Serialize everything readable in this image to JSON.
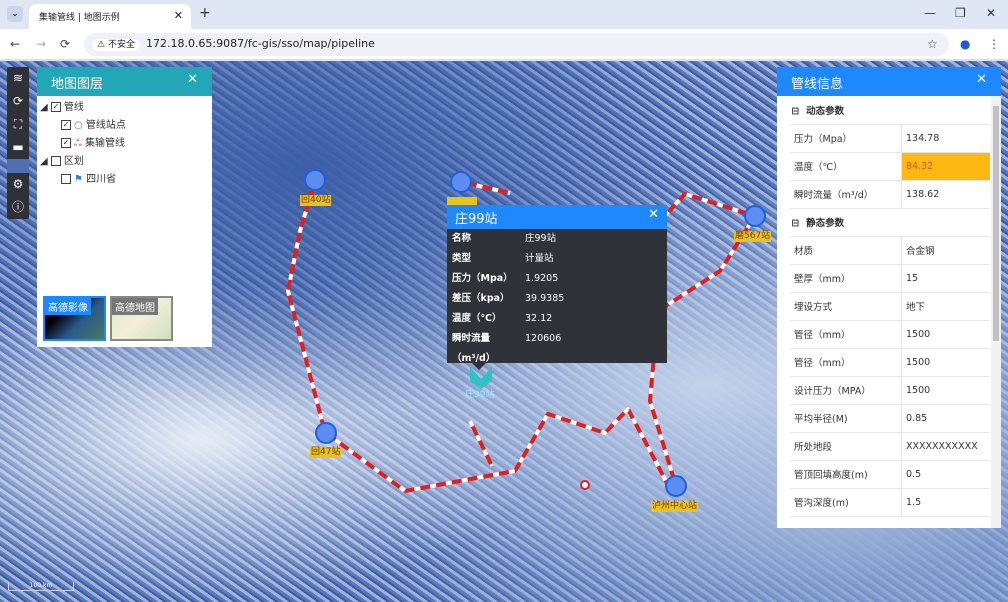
{
  "browser": {
    "tab_title": "集输管线 | 地图示例",
    "url": "172.18.0.65:9087/fc-gis/sso/map/pipeline",
    "security_label": "不安全"
  },
  "layers_panel": {
    "title": "地图图层",
    "tree": [
      {
        "label": "管线",
        "checked": true,
        "children": [
          {
            "label": "管线站点",
            "checked": true,
            "icon": "circle-icon"
          },
          {
            "label": "集输管线",
            "checked": true,
            "icon": "pipeline-icon"
          }
        ]
      },
      {
        "label": "区划",
        "checked": false,
        "children": [
          {
            "label": "四川省",
            "checked": false,
            "icon": "region-flag-icon"
          }
        ]
      }
    ],
    "basemaps": [
      {
        "label": "高德影像",
        "active": true
      },
      {
        "label": "高德地图",
        "active": false
      }
    ]
  },
  "info_panel": {
    "title": "管线信息",
    "groups": [
      {
        "title": "动态参数",
        "rows": [
          {
            "k": "压力（Mpa）",
            "v": "134.78"
          },
          {
            "k": "温度（℃）",
            "v": "84.32",
            "highlight": true
          },
          {
            "k": "瞬时流量（m³/d）",
            "v": "138.62"
          }
        ]
      },
      {
        "title": "静态参数",
        "rows": [
          {
            "k": "材质",
            "v": "合金钢"
          },
          {
            "k": "壁厚（mm）",
            "v": "15"
          },
          {
            "k": "埋设方式",
            "v": "地下"
          },
          {
            "k": "管径（mm）",
            "v": "1500"
          },
          {
            "k": "管径（mm）",
            "v": "1500"
          },
          {
            "k": "设计压力（MPA）",
            "v": "1500"
          },
          {
            "k": "平均半径(M)",
            "v": "0.85"
          },
          {
            "k": "所处地段",
            "v": "XXXXXXXXXXX"
          },
          {
            "k": "管顶回填高度(m)",
            "v": "0.5"
          },
          {
            "k": "管沟深度(m)",
            "v": "1.5"
          }
        ]
      }
    ],
    "highlight_color": "#fdb913"
  },
  "popup": {
    "title": "庄99站",
    "rows": [
      {
        "k": "名称",
        "v": "庄99站"
      },
      {
        "k": "类型",
        "v": "计量站"
      },
      {
        "k": "压力（Mpa）",
        "v": "1.9205"
      },
      {
        "k": "差压（kpa）",
        "v": "39.9385"
      },
      {
        "k": "温度（℃）",
        "v": "32.12"
      },
      {
        "k": "瞬时流量（m³/d）",
        "v": "120606"
      }
    ]
  },
  "stations": {
    "s40": "回40站",
    "s47": "回47站",
    "luzhou": "泸州中心站",
    "zhuang99": "庄99站",
    "s567": "磨567站"
  },
  "scale": "100 km",
  "colors": {
    "pipeline": "#e02020",
    "station": "#5b8ef0",
    "accent": "#1e88ff",
    "layers_header": "#22a7b8"
  }
}
